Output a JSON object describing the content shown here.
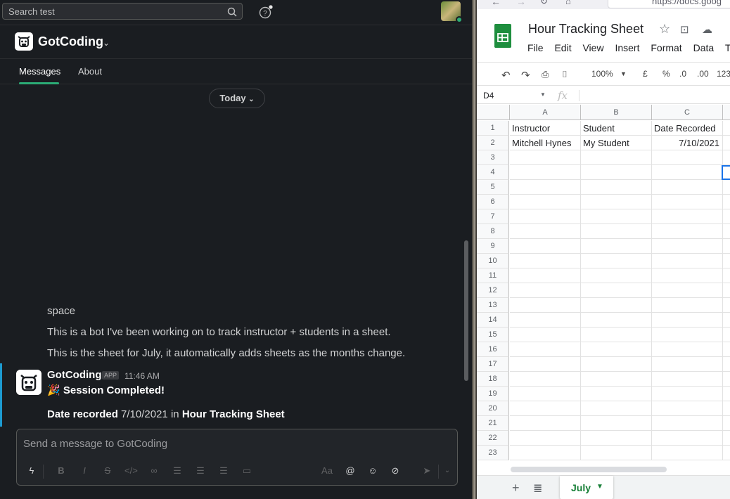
{
  "slack": {
    "search": {
      "placeholder": "Search test"
    },
    "channel": {
      "name": "GotCoding"
    },
    "tabs": [
      {
        "label": "Messages",
        "active": true
      },
      {
        "label": "About",
        "active": false
      }
    ],
    "date_divider": "Today",
    "messages": [
      "space",
      "This is a bot I've been working on to track instructor + students in a sheet.",
      "This is the sheet for July, it automatically adds sheets as the months change."
    ],
    "bot_message": {
      "author": "GotCoding",
      "badge": "APP",
      "time": "11:46 AM",
      "emoji": "🎉",
      "headline": "Session Completed!",
      "date_label": "Date recorded",
      "date_value": "7/10/2021",
      "in_word": "in",
      "sheet_name": "Hour Tracking Sheet"
    },
    "composer": {
      "placeholder": "Send a message to GotCoding"
    }
  },
  "sheets": {
    "url": "https://docs.goog",
    "title": "Hour Tracking Sheet",
    "menus": [
      "File",
      "Edit",
      "View",
      "Insert",
      "Format",
      "Data",
      "To"
    ],
    "toolbar": {
      "zoom": "100%",
      "currency": "£",
      "percent": "%",
      "dec_less": ".0",
      "dec_more": ".00",
      "format": "123"
    },
    "name_box": "D4",
    "fx": "fx",
    "columns": [
      "A",
      "B",
      "C"
    ],
    "rows": [
      "1",
      "2",
      "3",
      "4",
      "5",
      "6",
      "7",
      "8",
      "9",
      "10",
      "11",
      "12",
      "13",
      "14",
      "15",
      "16",
      "17",
      "18",
      "19",
      "20",
      "21",
      "22",
      "23"
    ],
    "cells": [
      [
        "Instructor",
        "Student",
        "Date Recorded"
      ],
      [
        "Mitchell Hynes",
        "My Student",
        "7/10/2021"
      ]
    ],
    "sheet_tab": "July",
    "accent": "#188038"
  }
}
